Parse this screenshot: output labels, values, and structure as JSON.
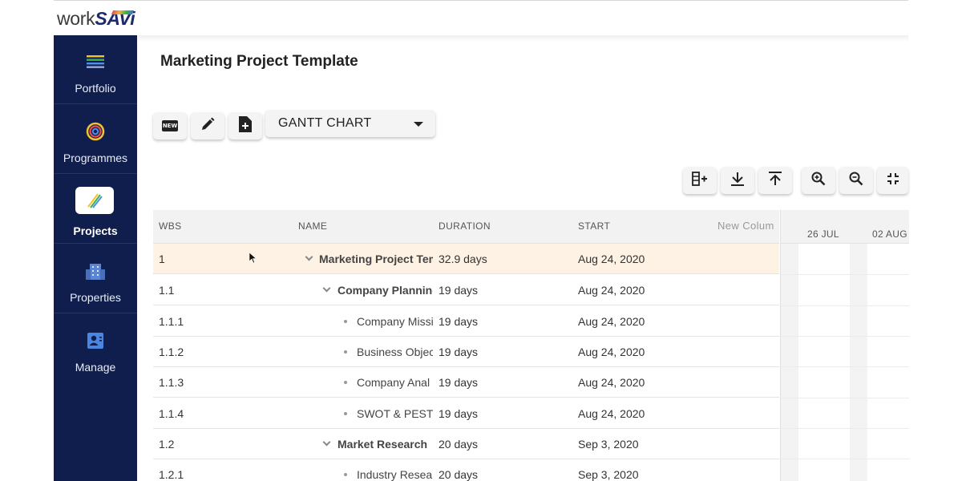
{
  "brand": {
    "prefix": "work",
    "suffix": "SAVi"
  },
  "sidebar": {
    "items": [
      {
        "label": "Portfolio",
        "icon": "portfolio-bars-icon"
      },
      {
        "label": "Programmes",
        "icon": "programmes-ring-icon"
      },
      {
        "label": "Projects",
        "icon": "projects-pencils-icon",
        "active": true
      },
      {
        "label": "Properties",
        "icon": "building-icon"
      },
      {
        "label": "Manage",
        "icon": "user-card-icon"
      }
    ]
  },
  "page": {
    "title": "Marketing Project Template"
  },
  "toolbar": {
    "buttons": [
      {
        "name": "new-button",
        "icon": "new-badge-icon",
        "badge": "NEW"
      },
      {
        "name": "edit-button",
        "icon": "pencil-icon"
      },
      {
        "name": "add-file-button",
        "icon": "file-plus-icon"
      }
    ],
    "view_select": {
      "value": "GANTT CHART"
    }
  },
  "grid_toolbar": {
    "buttons": [
      {
        "name": "add-column-button",
        "icon": "column-plus-icon"
      },
      {
        "name": "indent-button",
        "icon": "arrow-down-bar-icon"
      },
      {
        "name": "outdent-button",
        "icon": "arrow-up-bar-icon"
      },
      {
        "name": "zoom-in-button",
        "icon": "zoom-in-icon"
      },
      {
        "name": "zoom-out-button",
        "icon": "zoom-out-icon"
      },
      {
        "name": "fit-button",
        "icon": "collapse-icon"
      }
    ]
  },
  "grid": {
    "columns": [
      "WBS",
      "NAME",
      "DURATION",
      "START",
      "New Column"
    ],
    "rows": [
      {
        "wbs": "1",
        "name": "Marketing Project Tem",
        "duration": "32.9 days",
        "start": "Aug 24, 2020",
        "level": 0,
        "type": "group"
      },
      {
        "wbs": "1.1",
        "name": "Company Planning",
        "duration": "19 days",
        "start": "Aug 24, 2020",
        "level": 1,
        "type": "group"
      },
      {
        "wbs": "1.1.1",
        "name": "Company Missi",
        "duration": "19 days",
        "start": "Aug 24, 2020",
        "level": 2,
        "type": "leaf"
      },
      {
        "wbs": "1.1.2",
        "name": "Business Objec",
        "duration": "19 days",
        "start": "Aug 24, 2020",
        "level": 2,
        "type": "leaf"
      },
      {
        "wbs": "1.1.3",
        "name": "Company Anal",
        "duration": "19 days",
        "start": "Aug 24, 2020",
        "level": 2,
        "type": "leaf"
      },
      {
        "wbs": "1.1.4",
        "name": "SWOT & PEST",
        "duration": "19 days",
        "start": "Aug 24, 2020",
        "level": 2,
        "type": "leaf"
      },
      {
        "wbs": "1.2",
        "name": "Market Research",
        "duration": "20 days",
        "start": "Sep 3, 2020",
        "level": 1,
        "type": "group"
      },
      {
        "wbs": "1.2.1",
        "name": "Industry Resear",
        "duration": "20 days",
        "start": "Sep 3, 2020",
        "level": 2,
        "type": "leaf"
      }
    ]
  },
  "gantt": {
    "weeks": [
      "26 JUL",
      "02 AUG"
    ]
  },
  "colors": {
    "sidebar": "#0f1e4d",
    "highlight_row": "#fdf2e4",
    "accent": "#1f2a6b"
  }
}
